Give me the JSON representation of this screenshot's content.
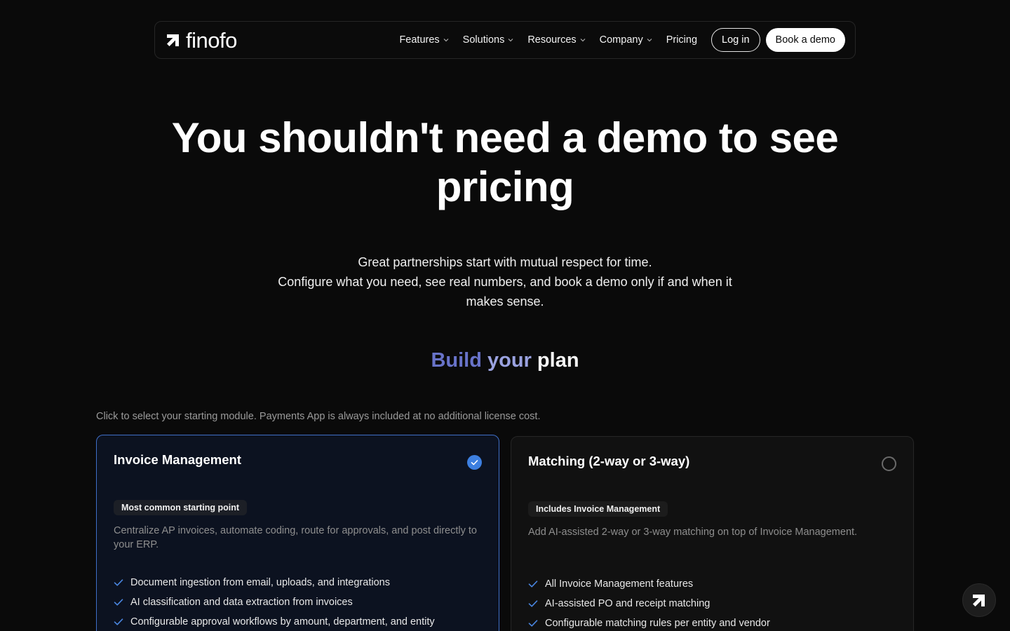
{
  "brand": {
    "name": "finofo",
    "logo_icon": "arrow-up-right-icon"
  },
  "nav": {
    "items": [
      {
        "label": "Features",
        "dropdown": true
      },
      {
        "label": "Solutions",
        "dropdown": true
      },
      {
        "label": "Resources",
        "dropdown": true
      },
      {
        "label": "Company",
        "dropdown": true
      }
    ],
    "pricing_label": "Pricing",
    "login_label": "Log in",
    "demo_label": "Book a demo"
  },
  "hero": {
    "title": "You shouldn't need a demo to see pricing",
    "subtitle_line1": "Great partnerships start with mutual respect for time.",
    "subtitle_line2": "Configure what you need, see real numbers, and book a demo only if and when it makes sense."
  },
  "plan": {
    "heading_part1": "Build",
    "heading_part2": "your",
    "heading_part3": "plan",
    "instruction": "Click to select your starting module. Payments App is always included at no additional license cost.",
    "colors": {
      "selected_border": "#3f6fc8",
      "check": "#3d7fe0",
      "heading_gradient_start": "#6873c9"
    },
    "modules": [
      {
        "title": "Invoice Management",
        "selected": true,
        "badge": "Most common starting point",
        "description": "Centralize AP invoices, automate coding, route for approvals, and post directly to your ERP.",
        "features": [
          "Document ingestion from email, uploads, and integrations",
          "AI classification and data extraction from invoices",
          "Configurable approval workflows by amount, department, and entity"
        ]
      },
      {
        "title": "Matching (2-way or 3-way)",
        "selected": false,
        "badge": "Includes Invoice Management",
        "description": "Add AI-assisted 2-way or 3-way matching on top of Invoice Management.",
        "features": [
          "All Invoice Management features",
          "AI-assisted PO and receipt matching",
          "Configurable matching rules per entity and vendor"
        ]
      }
    ]
  },
  "fab": {
    "icon": "finofo-logo-icon"
  }
}
